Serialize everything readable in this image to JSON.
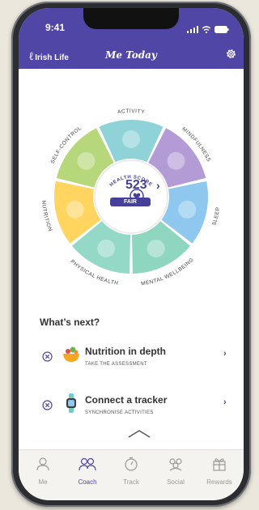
{
  "status_bar": {
    "time": "9:41"
  },
  "header": {
    "brand": "Irish Life",
    "title": "Me Today",
    "settings_icon": "gear-icon"
  },
  "wheel": {
    "segments": [
      {
        "label": "ACTIVITY",
        "color": "#8fd2d8",
        "icon": "running-shoe-icon"
      },
      {
        "label": "MINDFULNESS",
        "color": "#b39bd5",
        "icon": "lotus-icon"
      },
      {
        "label": "SLEEP",
        "color": "#8ec8ee",
        "icon": "bed-icon"
      },
      {
        "label": "MENTAL WELLBEING",
        "color": "#8fd6c0",
        "icon": "head-brain-icon"
      },
      {
        "label": "PHYSICAL HEALTH",
        "color": "#94d9c7",
        "icon": "body-icon"
      },
      {
        "label": "NUTRITION",
        "color": "#ffd560",
        "icon": "vegetable-bowl-icon"
      },
      {
        "label": "SELF-CONTROL",
        "color": "#b6d77a",
        "icon": "bottle-cigarette-icon"
      }
    ],
    "health_score_label": "HEALTH SCORE",
    "score": "523",
    "rating": "FAIR"
  },
  "whats_next": {
    "title": "What’s next?",
    "items": [
      {
        "title": "Nutrition in depth",
        "subtitle": "TAKE THE ASSESSMENT",
        "icon": "nutrition-bowl-icon"
      },
      {
        "title": "Connect a tracker",
        "subtitle": "SYNCHRONISE ACTIVITIES",
        "icon": "fitness-tracker-icon"
      }
    ]
  },
  "tabs": [
    {
      "label": "Me",
      "icon": "person-icon",
      "active": false
    },
    {
      "label": "Coach",
      "icon": "people-icon",
      "active": true
    },
    {
      "label": "Track",
      "icon": "stopwatch-icon",
      "active": false
    },
    {
      "label": "Social",
      "icon": "group-icon",
      "active": false
    },
    {
      "label": "Rewards",
      "icon": "gift-icon",
      "active": false
    }
  ],
  "colors": {
    "brand": "#5046a6",
    "score": "#46409a",
    "inactive_tab": "#9a9a9a"
  }
}
